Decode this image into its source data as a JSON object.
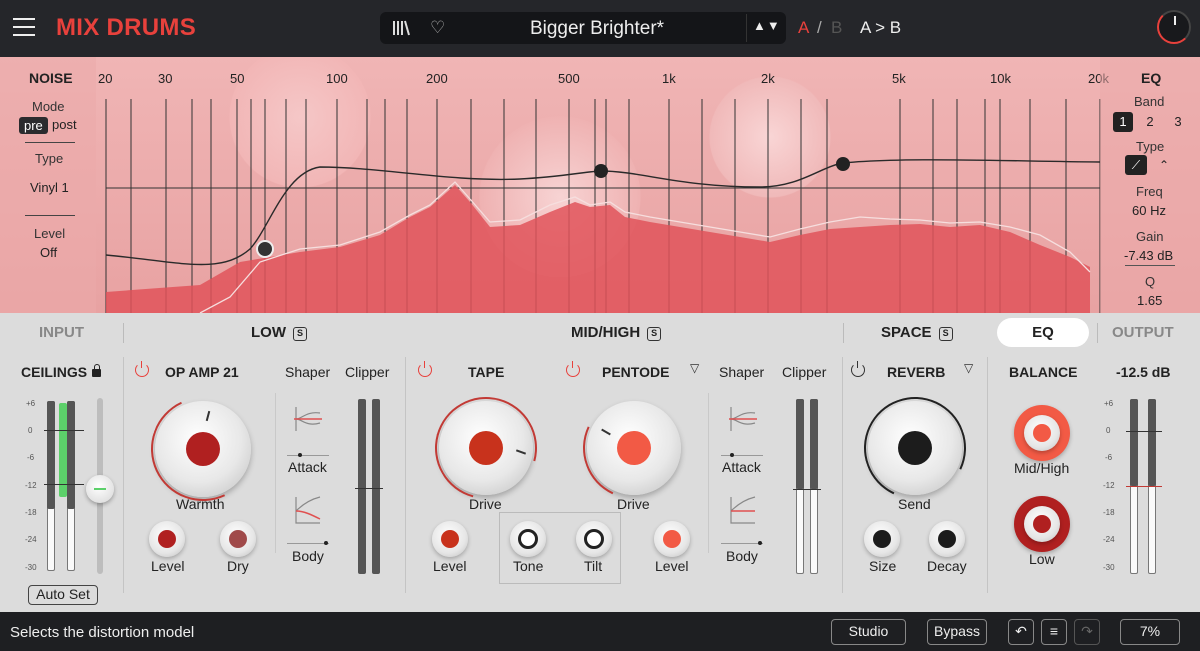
{
  "app": {
    "title": "MIX DRUMS"
  },
  "preset": {
    "name": "Bigger Brighter*",
    "arrows": "▲▼",
    "a": "A",
    "slash": "/",
    "b": "B",
    "copy": "A > B"
  },
  "noise": {
    "title": "NOISE",
    "mode_label": "Mode",
    "mode_pre": "pre",
    "mode_post": "post",
    "type_label": "Type",
    "type_value": "Vinyl 1",
    "level_label": "Level",
    "level_value": "Off"
  },
  "freq_axis": [
    "20",
    "30",
    "50",
    "100",
    "200",
    "500",
    "1k",
    "2k",
    "5k",
    "10k",
    "20k"
  ],
  "eq_panel": {
    "title": "EQ",
    "band_label": "Band",
    "bands": [
      "1",
      "2",
      "3"
    ],
    "active_band": "1",
    "type_label": "Type",
    "freq_label": "Freq",
    "freq_value": "60 Hz",
    "gain_label": "Gain",
    "gain_value": "-7.43 dB",
    "q_label": "Q",
    "q_value": "1.65"
  },
  "sections": {
    "input": "INPUT",
    "low": "LOW",
    "midhigh": "MID/HIGH",
    "space": "SPACE",
    "eq": "EQ",
    "output": "OUTPUT",
    "solo": "S"
  },
  "input": {
    "ceilings": "CEILINGS",
    "scale": [
      "+6",
      "0",
      "-6",
      "-12",
      "-18",
      "-24",
      "-30"
    ],
    "auto_set": "Auto Set"
  },
  "low": {
    "model": "OP AMP 21",
    "shaper": "Shaper",
    "clipper": "Clipper",
    "warmth": "Warmth",
    "level": "Level",
    "dry": "Dry",
    "attack": "Attack",
    "body": "Body"
  },
  "midhigh": {
    "tape": "TAPE",
    "pentode": "PENTODE",
    "shaper": "Shaper",
    "clipper": "Clipper",
    "drive1": "Drive",
    "drive2": "Drive",
    "level1": "Level",
    "tone": "Tone",
    "tilt": "Tilt",
    "level2": "Level",
    "attack": "Attack",
    "body": "Body"
  },
  "space": {
    "model": "REVERB",
    "send": "Send",
    "size": "Size",
    "decay": "Decay"
  },
  "balance": {
    "title": "BALANCE",
    "midhigh": "Mid/High",
    "low": "Low"
  },
  "output": {
    "value": "-12.5 dB",
    "scale": [
      "+6",
      "0",
      "-6",
      "-12",
      "-18",
      "-24",
      "-30"
    ]
  },
  "status": {
    "message": "Selects the distortion model",
    "studio": "Studio",
    "bypass": "Bypass",
    "zoom": "7%",
    "undo": "↶",
    "list": "≡",
    "redo": "↷"
  },
  "colors": {
    "accent": "#e8413c",
    "topbar": "#25262a",
    "display": "#efb4b4",
    "panel": "#dcdcdc"
  }
}
